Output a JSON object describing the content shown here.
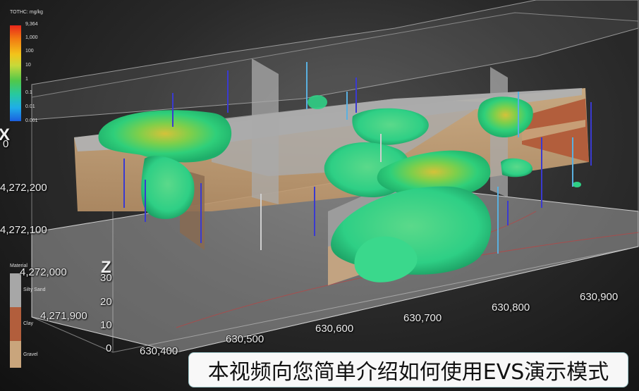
{
  "legend": {
    "title": "TOTHC: mg/kg",
    "ticks": [
      "9,364",
      "1,000",
      "100",
      "10",
      "1",
      "0.1",
      "0.01",
      "0.001"
    ]
  },
  "material": {
    "title": "Material",
    "items": [
      {
        "label": "Silty Sand",
        "color": "#a7a7a7"
      },
      {
        "label": "Clay",
        "color": "#b25e3c"
      },
      {
        "label": "Gravel",
        "color": "#c9a57c"
      }
    ]
  },
  "axes": {
    "x_axis_letter": "X",
    "x_ticks": [
      "630,400",
      "630,500",
      "630,600",
      "630,700",
      "630,800",
      "630,900"
    ],
    "y_ticks": [
      "0",
      "4,272,200",
      "4,272,100",
      "4,272,000",
      "4,271,900"
    ],
    "z_axis_letter": "Z",
    "z_ticks": [
      "30",
      "20",
      "10",
      "0"
    ]
  },
  "caption": {
    "text": "本视频向您简单介绍如何使用EVS演示模式"
  },
  "colors": {
    "plume": "#2fcf85",
    "plume_core": "#d8c43a",
    "silty_sand": "#a7a7a7",
    "clay": "#b25e3c",
    "gravel": "#c9a57c"
  }
}
